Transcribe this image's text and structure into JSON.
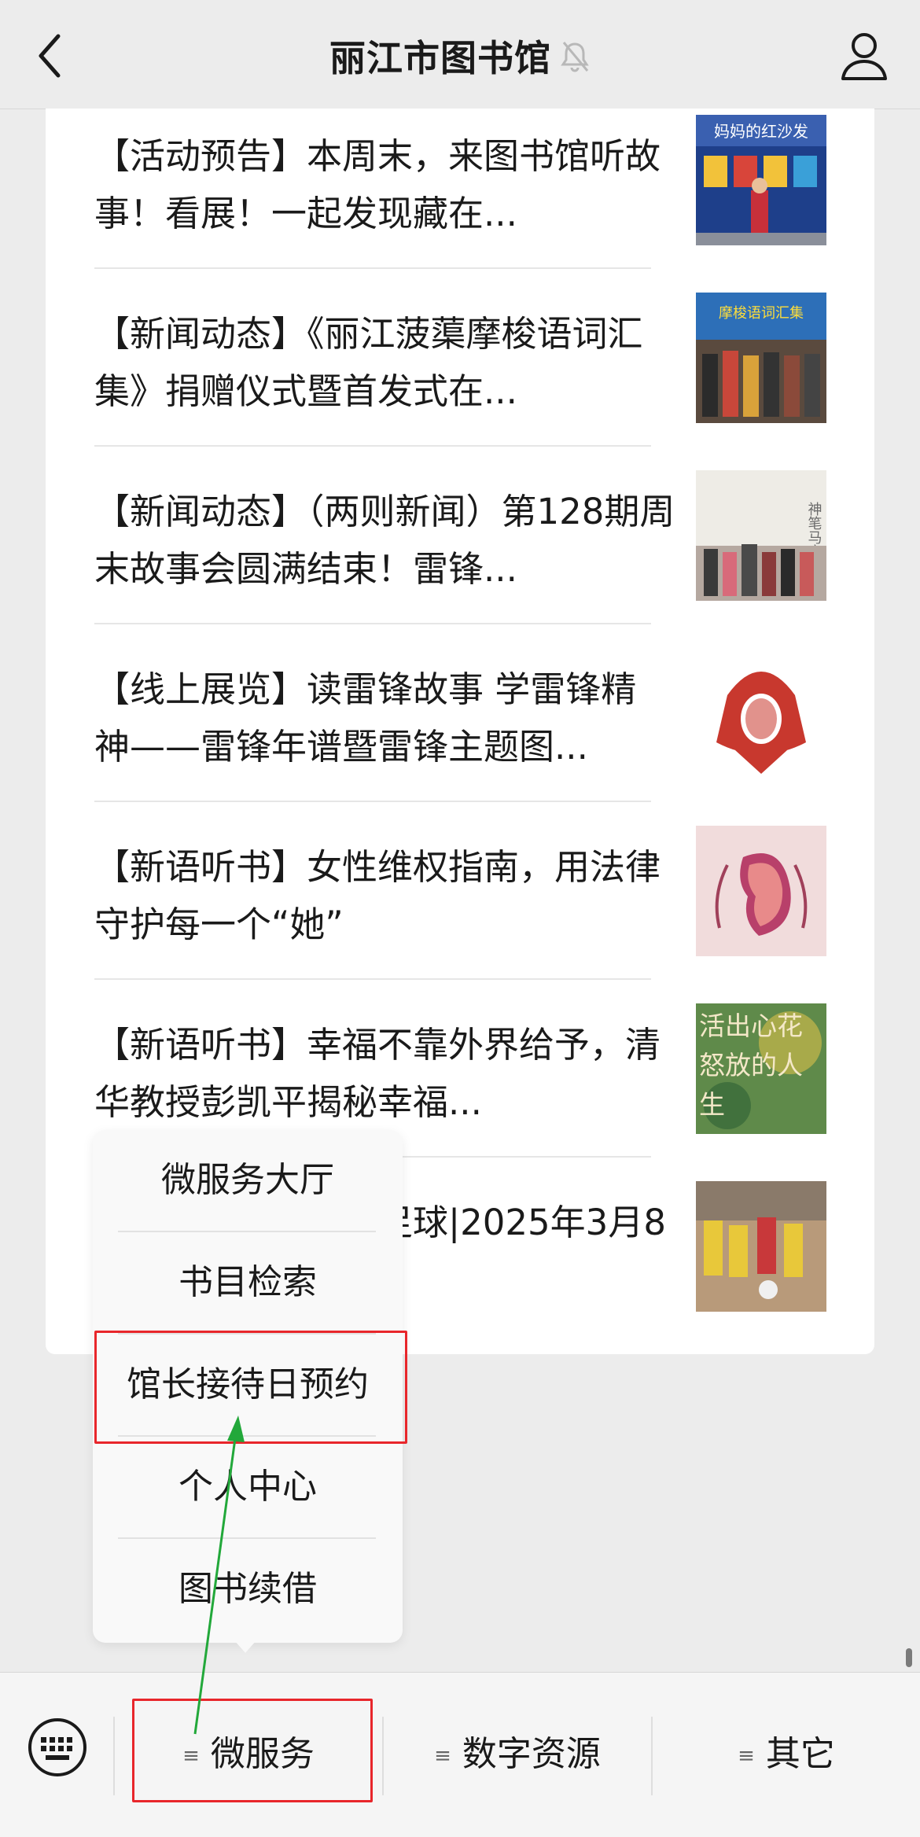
{
  "header": {
    "title": "丽江市图书馆"
  },
  "articles": [
    {
      "title": "【活动预告】本周末，来图书馆听故事！看展！一起发现藏在...",
      "thumb_text": "妈妈的红沙发"
    },
    {
      "title": "【新闻动态】《丽江菠蕖摩梭语词汇集》捐赠仪式暨首发式在...",
      "thumb_text": "摩梭语词汇集"
    },
    {
      "title": "【新闻动态】（两则新闻）第128期周末故事会圆满结束！雷锋...",
      "thumb_text": "神笔马良"
    },
    {
      "title": "【线上展览】读雷锋故事 学雷锋精神——雷锋年谱暨雷锋主题图...",
      "thumb_text": ""
    },
    {
      "title": "【新语听书】女性维权指南，用法律守护每一个“她”",
      "thumb_text": ""
    },
    {
      "title": "【新语听书】幸福不靠外界给予，清华教授彭凯平揭秘幸福...",
      "thumb_text": "活出心花怒放的人生"
    },
    {
      "title": "【活动预告】屋顶足球|2025年3月8日...",
      "thumb_text": ""
    }
  ],
  "popup_menu": {
    "items": [
      "微服务大厅",
      "书目检索",
      "馆长接待日预约",
      "个人中心",
      "图书续借"
    ]
  },
  "bottom_bar": {
    "tabs": [
      "微服务",
      "数字资源",
      "其它"
    ]
  },
  "colors": {
    "highlight": "#e8262b",
    "arrow": "#22a83a"
  }
}
